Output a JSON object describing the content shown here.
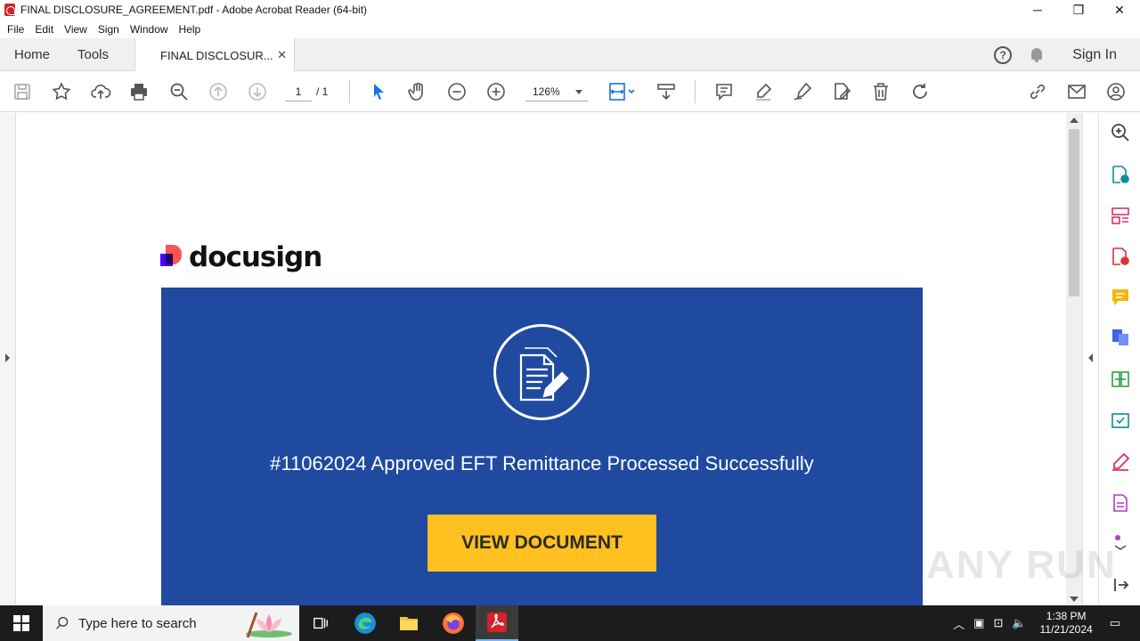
{
  "window": {
    "title": "FINAL DISCLOSURE_AGREEMENT.pdf - Adobe Acrobat Reader (64-bit)",
    "controls": {
      "minimize": "─",
      "maximize": "❐",
      "close": "✕"
    }
  },
  "menu": [
    "File",
    "Edit",
    "View",
    "Sign",
    "Window",
    "Help"
  ],
  "tabs": {
    "home": "Home",
    "tools": "Tools",
    "document": "FINAL DISCLOSUR...",
    "document_close": "✕"
  },
  "header_right": {
    "help": "?",
    "sign_in": "Sign In"
  },
  "toolbar": {
    "page_current": "1",
    "page_total": "/ 1",
    "zoom": "126%"
  },
  "document": {
    "logo_text": "docusign",
    "headline": "#11062024 Approved EFT Remittance Processed Successfully",
    "cta_label": "VIEW DOCUMENT",
    "colors": {
      "banner": "#1f4aa0",
      "cta": "#ffc020"
    }
  },
  "watermark": "ANY RUN",
  "taskbar": {
    "search_placeholder": "Type here to search",
    "time": "1:38 PM",
    "date": "11/21/2024"
  }
}
